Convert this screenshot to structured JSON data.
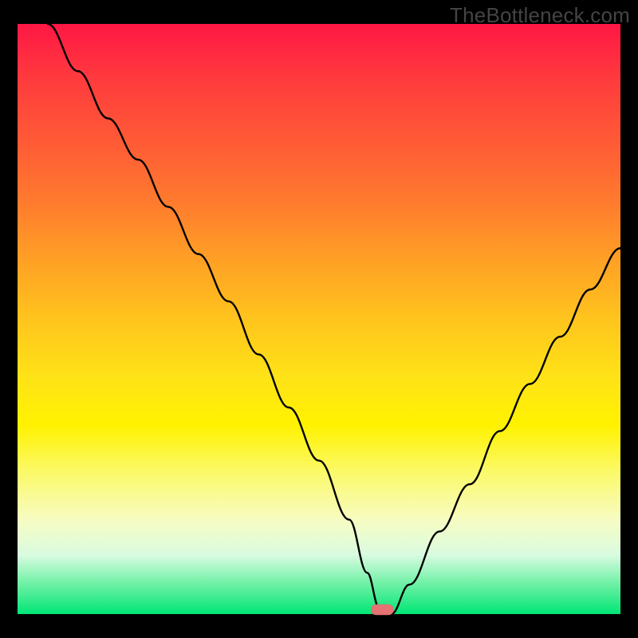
{
  "watermark": "TheBottleneck.com",
  "chart_data": {
    "type": "line",
    "title": "",
    "xlabel": "",
    "ylabel": "",
    "xlim": [
      0,
      100
    ],
    "ylim": [
      0,
      100
    ],
    "grid": false,
    "legend": false,
    "series": [
      {
        "name": "bottleneck-curve",
        "x": [
          5,
          10,
          15,
          20,
          25,
          30,
          35,
          40,
          45,
          50,
          55,
          58,
          60,
          61,
          62,
          65,
          70,
          75,
          80,
          85,
          90,
          95,
          100
        ],
        "values": [
          100,
          92,
          84,
          77,
          69,
          61,
          53,
          44,
          35,
          26,
          16,
          7,
          1,
          0,
          0,
          5,
          14,
          22,
          31,
          39,
          47,
          55,
          62
        ]
      }
    ],
    "marker": {
      "x": 60.5,
      "y": 0,
      "shape": "pill",
      "color": "#e57373"
    },
    "annotations": []
  },
  "colors": {
    "frame": "#000000",
    "gradient_top": "#ff1744",
    "gradient_mid": "#fff200",
    "gradient_bottom": "#00e676",
    "curve": "#000000",
    "marker": "#e57373",
    "watermark": "#444444"
  }
}
